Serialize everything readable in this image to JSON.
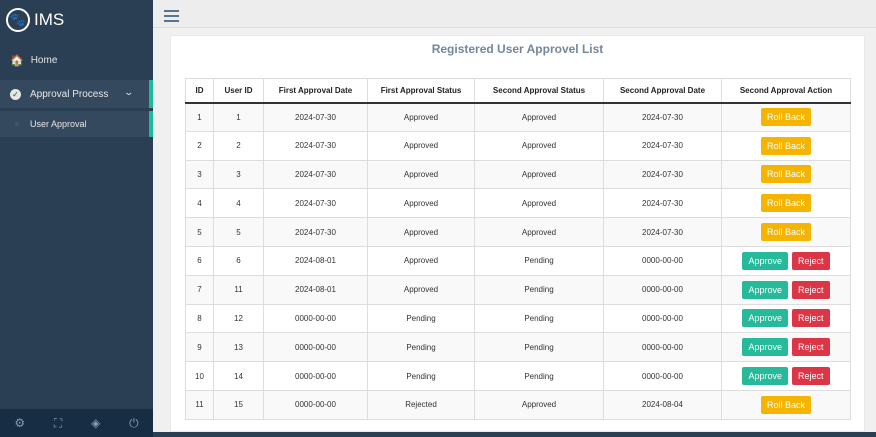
{
  "app": {
    "title": "IMS"
  },
  "sidebar": {
    "home_label": "Home",
    "approval_label": "Approval Process",
    "sub_label": "User Approval"
  },
  "panel": {
    "title": "Registered User Approvel List"
  },
  "table": {
    "headers": [
      "ID",
      "User ID",
      "First Approval Date",
      "First Approval Status",
      "Second Approval Status",
      "Second Approval Date",
      "Second Approval Action"
    ],
    "rows": [
      {
        "id": "1",
        "user_id": "1",
        "first_date": "2024-07-30",
        "first_status": "Approved",
        "second_status": "Approved",
        "second_date": "2024-07-30",
        "actions": [
          "Roll Back"
        ]
      },
      {
        "id": "2",
        "user_id": "2",
        "first_date": "2024-07-30",
        "first_status": "Approved",
        "second_status": "Approved",
        "second_date": "2024-07-30",
        "actions": [
          "Roll Back"
        ]
      },
      {
        "id": "3",
        "user_id": "3",
        "first_date": "2024-07-30",
        "first_status": "Approved",
        "second_status": "Approved",
        "second_date": "2024-07-30",
        "actions": [
          "Roll Back"
        ]
      },
      {
        "id": "4",
        "user_id": "4",
        "first_date": "2024-07-30",
        "first_status": "Approved",
        "second_status": "Approved",
        "second_date": "2024-07-30",
        "actions": [
          "Roll Back"
        ]
      },
      {
        "id": "5",
        "user_id": "5",
        "first_date": "2024-07-30",
        "first_status": "Approved",
        "second_status": "Approved",
        "second_date": "2024-07-30",
        "actions": [
          "Roll Back"
        ]
      },
      {
        "id": "6",
        "user_id": "6",
        "first_date": "2024-08-01",
        "first_status": "Approved",
        "second_status": "Pending",
        "second_date": "0000-00-00",
        "actions": [
          "Approve",
          "Reject"
        ]
      },
      {
        "id": "7",
        "user_id": "11",
        "first_date": "2024-08-01",
        "first_status": "Approved",
        "second_status": "Pending",
        "second_date": "0000-00-00",
        "actions": [
          "Approve",
          "Reject"
        ]
      },
      {
        "id": "8",
        "user_id": "12",
        "first_date": "0000-00-00",
        "first_status": "Pending",
        "second_status": "Pending",
        "second_date": "0000-00-00",
        "actions": [
          "Approve",
          "Reject"
        ]
      },
      {
        "id": "9",
        "user_id": "13",
        "first_date": "0000-00-00",
        "first_status": "Pending",
        "second_status": "Pending",
        "second_date": "0000-00-00",
        "actions": [
          "Approve",
          "Reject"
        ]
      },
      {
        "id": "10",
        "user_id": "14",
        "first_date": "0000-00-00",
        "first_status": "Pending",
        "second_status": "Pending",
        "second_date": "0000-00-00",
        "actions": [
          "Approve",
          "Reject"
        ]
      },
      {
        "id": "11",
        "user_id": "15",
        "first_date": "0000-00-00",
        "first_status": "Rejected",
        "second_status": "Approved",
        "second_date": "2024-08-04",
        "actions": [
          "Roll Back"
        ]
      }
    ]
  },
  "icons": {
    "brand": "paw-icon",
    "home": "home-icon",
    "approval": "check-circle-icon",
    "footer": [
      "gear-icon",
      "fullscreen-icon",
      "eye-slash-icon",
      "power-icon"
    ]
  },
  "colors": {
    "sidebar": "#2a3f54",
    "accent": "#1abb9c",
    "rollback": "#f4b400",
    "approve": "#26b99a",
    "reject": "#dc3545"
  }
}
